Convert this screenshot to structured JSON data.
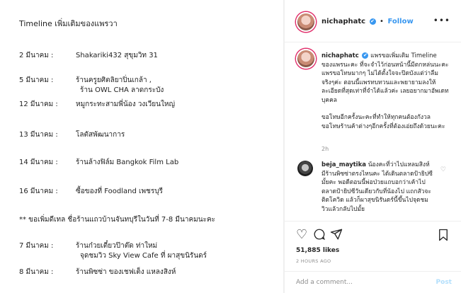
{
  "post_image": {
    "title": "Timeline เพิ่มเติมของแพรวา",
    "entries": [
      {
        "date": "2  มีนาคม :",
        "text": "Shakariki432 สุขุมวิท 31",
        "text2": ""
      },
      {
        "date": "5  มีนาคม :",
        "text": "ร้านครูยศิตลิยาปิ่นเกล้า ,",
        "text2": "ร้าน OWL CHA  ลาดกระบัง"
      },
      {
        "date": "12 มีนาคม :",
        "text": "หมูกระทะสามพี่น้อง วงเวียนใหญ่",
        "text2": ""
      },
      {
        "date": "13 มีนาคม :",
        "text": "โลตัสพัฒนาการ",
        "text2": ""
      },
      {
        "date": "14 มีนาคม :",
        "text": "ร้านล้างฟิล์ม Bangkok Film Lab",
        "text2": ""
      },
      {
        "date": "16 มีนาคม :",
        "text": "ซื้อของที่ Foodland เพชรบุรี",
        "text2": ""
      },
      {
        "date": "7 มีนาคม :",
        "text": "ร้านก๋วยเตี๋ยวป๊าต๊ด ท่าใหม่",
        "text2": "จุดชมวิว Sky View Cafe ที่ ผาสุขนิรันดร์"
      },
      {
        "date": "8 มีนาคม :",
        "text": "ร้านพิซซ่า ของเชฟเต็ง แหลงสิงห์",
        "text2": ""
      }
    ],
    "note": "** ขอเพิ่มดีเทล ชื่อร้านแถวบ้านจันทบุรีในวันที่ 7-8 มีนาคมนะคะ"
  },
  "header": {
    "username": "nichaphatc",
    "verified_mark": "✔",
    "separator": "•",
    "follow_label": "Follow",
    "more_icon": "•••"
  },
  "caption": {
    "username": "nichaphatc",
    "verified_mark": "✔",
    "para1": "แพรขอเพิ่มเติม Timeline ของแพรนะคะ ที่จะจำไว้ก่อนหน้านี้มีตกหล่นนะคะ แพรขอโทษมากๆ ไม่ได้ตั้งใจจะปิดบังแต่ว่าลืมจริงๆค่ะ ตอนนี้แพรทบทวนและพยายามลงให้ละเอียดที่สุดเท่าที่จำได้แล้วค่ะ เลยอยากมาอัพเดทบุคคล",
    "para2": "ขอโทษอีกครั้งนะคะที่ทำให้ทุกคนต้องกังวล ขอโทษร้านค้าต่างๆอีกครั้งที่ต้องเอ่ยถึงด้วยนะคะ",
    "time": "2h"
  },
  "comment": {
    "username": "beja_maytika",
    "text": "น้องคะที่ว่าไปแหลมสิงห์ มีร้านพิซซ่าตรงไหนคะ ได้เดินตลาดป้ายิปซีมั้ยคะ พอดีตอนนี้พ่อป่วยแถบอกว่าเค้าไปตลาดป้ายิปซีวันเดียวกับที่น้องไป แถกสัวจะติดโควิด แล้วก็ผาสุขนิรันดร์นี้ขึ้นไปจุดชมวิวแล้วกลับไปมั้ย"
  },
  "actions": {
    "likes": "51,885 likes",
    "time_ago": "2 HOURS AGO"
  },
  "add_comment": {
    "placeholder": "Add a comment...",
    "post_label": "Post"
  }
}
